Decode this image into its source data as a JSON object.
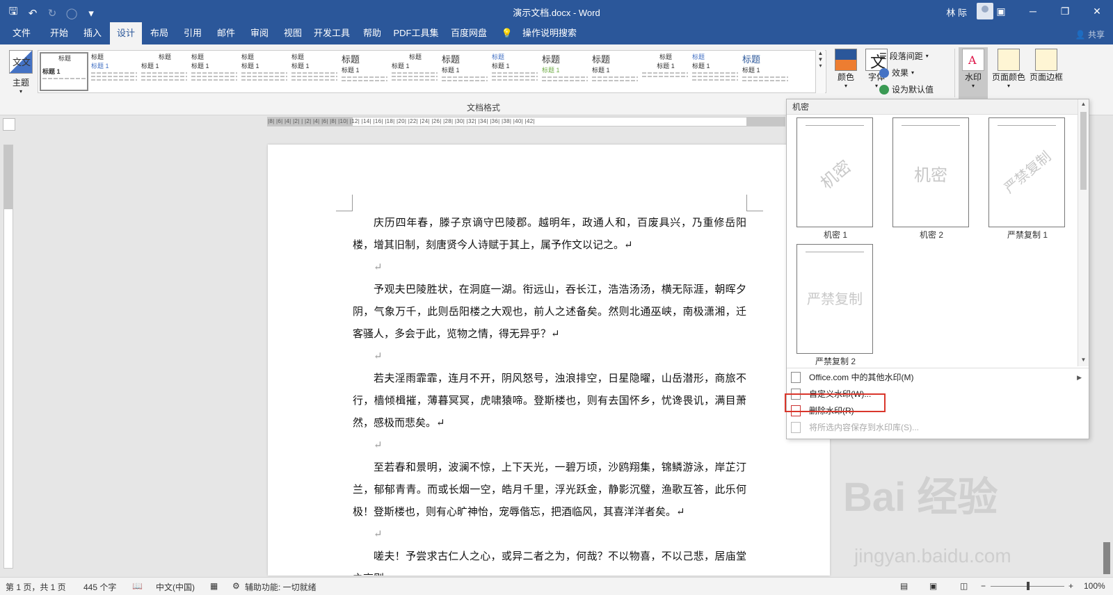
{
  "window": {
    "title": "演示文档.docx - Word",
    "user": "林 际",
    "qat_icons": [
      "save-icon",
      "undo-icon",
      "redo-icon",
      "circle-icon",
      "customize-icon"
    ]
  },
  "tabs": [
    "文件",
    "开始",
    "插入",
    "设计",
    "布局",
    "引用",
    "邮件",
    "审阅",
    "视图",
    "开发工具",
    "帮助",
    "PDF工具集",
    "百度网盘",
    "操作说明搜索"
  ],
  "active_tab": "设计",
  "share_label": "共享",
  "ribbon": {
    "theme_label": "主题",
    "theme_icon_text": "文文",
    "style_title": "标题",
    "style_title1": "标题 1",
    "group_label": "文档格式",
    "colors_label": "颜色",
    "fonts_label": "字体",
    "fonts_icon_text": "文",
    "paragraph_spacing_label": "段落间距",
    "effects_label": "效果",
    "set_default_label": "设为默认值",
    "watermark_label": "水印",
    "page_color_label": "页面颜色",
    "page_border_label": "页面边框"
  },
  "ruler_text": "|8| |6| |4| |2| |  |2| |4| |6| |8| |10| |12| |14| |16| |18| |20| |22| |24| |26| |28| |30| |32| |34| |36| |38| |40| |42|",
  "document": {
    "paragraphs": [
      "庆历四年春，滕子京谪守巴陵郡。越明年，政通人和，百废具兴，乃重修岳阳楼，增其旧制，刻唐贤今人诗赋于其上，属予作文以记之。↵",
      "↵",
      "予观夫巴陵胜状，在洞庭一湖。衔远山，吞长江，浩浩汤汤，横无际涯，朝晖夕阴，气象万千，此则岳阳楼之大观也，前人之述备矣。然则北通巫峡，南极潇湘，迁客骚人，多会于此，览物之情，得无异乎？↵",
      "↵",
      "若夫淫雨霏霏，连月不开，阴风怒号，浊浪排空，日星隐曜，山岳潜形，商旅不行，樯倾楫摧，薄暮冥冥，虎啸猿啼。登斯楼也，则有去国怀乡，忧谗畏讥，满目萧然，感极而悲矣。↵",
      "↵",
      "至若春和景明，波澜不惊，上下天光，一碧万顷，沙鸥翔集，锦鳞游泳，岸芷汀兰，郁郁青青。而或长烟一空，皓月千里，浮光跃金，静影沉璧，渔歌互答，此乐何极！登斯楼也，则有心旷神怡，宠辱偕忘，把酒临风，其喜洋洋者矣。↵",
      "↵",
      "嗟夫！予尝求古仁人之心，或异二者之为，何哉？不以物喜，不以己悲，居庙堂之高则"
    ]
  },
  "watermark_menu": {
    "section_header": "机密",
    "items": [
      {
        "caption": "机密 1",
        "text": "机密"
      },
      {
        "caption": "机密 2",
        "text": "机密"
      },
      {
        "caption": "严禁复制 1",
        "text": "严禁复制"
      },
      {
        "caption": "严禁复制 2",
        "text": "严禁复制"
      }
    ],
    "menu": {
      "more": "Office.com 中的其他水印(M)",
      "custom": "自定义水印(W)...",
      "remove": "删除水印(R)",
      "save": "将所选内容保存到水印库(S)..."
    }
  },
  "status": {
    "page": "第 1 页，共 1 页",
    "words": "445 个字",
    "language": "中文(中国)",
    "accessibility": "辅助功能: 一切就绪",
    "zoom": "100%"
  },
  "overlay": {
    "logo": "Bai 经验",
    "url": "jingyan.baidu.com"
  },
  "colors": {
    "brand": "#2b579a",
    "highlight": "#d9362b"
  }
}
